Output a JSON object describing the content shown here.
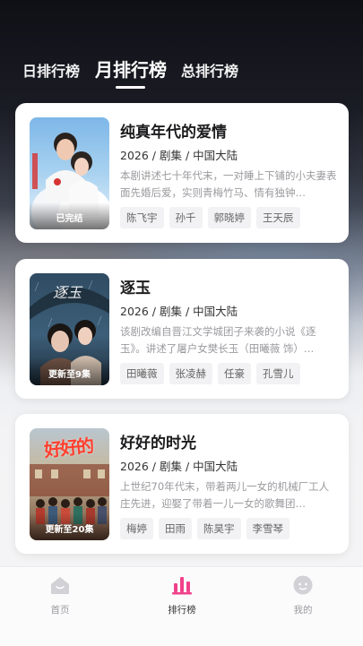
{
  "tabs": [
    {
      "label": "日排行榜",
      "active": false
    },
    {
      "label": "月排行榜",
      "active": true
    },
    {
      "label": "总排行榜",
      "active": false
    }
  ],
  "dramas": [
    {
      "title": "纯真年代的爱情",
      "meta": "2026 / 剧集 / 中国大陆",
      "description": "本剧讲述七十年代末，一对睡上下铺的小夫妻表面先婚后爱，实则青梅竹马、情有独钟…",
      "badge": "已完结",
      "poster_text": "",
      "cast": [
        "陈飞宇",
        "孙千",
        "郭晓婷",
        "王天辰"
      ]
    },
    {
      "title": "逐玉",
      "meta": "2026 / 剧集 / 中国大陆",
      "description": "该剧改编自晋江文学城团子来袭的小说《逐玉》。讲述了屠户女樊长玉（田曦薇 饰）…",
      "badge": "更新至9集",
      "poster_text": "逐玉",
      "cast": [
        "田曦薇",
        "张凌赫",
        "任豪",
        "孔雪儿"
      ]
    },
    {
      "title": "好好的时光",
      "meta": "2026 / 剧集 / 中国大陆",
      "description": "上世纪70年代末，带着两儿一女的机械厂工人庄先进，迎娶了带着一儿一女的歌舞团…",
      "badge": "更新至20集",
      "poster_text": "好好的",
      "cast": [
        "梅婷",
        "田雨",
        "陈昊宇",
        "李雪琴"
      ]
    }
  ],
  "nav": [
    {
      "label": "首页",
      "icon": "home-icon",
      "active": false
    },
    {
      "label": "排行榜",
      "icon": "ranking-icon",
      "active": true
    },
    {
      "label": "我的",
      "icon": "profile-icon",
      "active": false
    }
  ],
  "colors": {
    "accent": "#f1418a",
    "inactive": "#c9c9cd"
  }
}
